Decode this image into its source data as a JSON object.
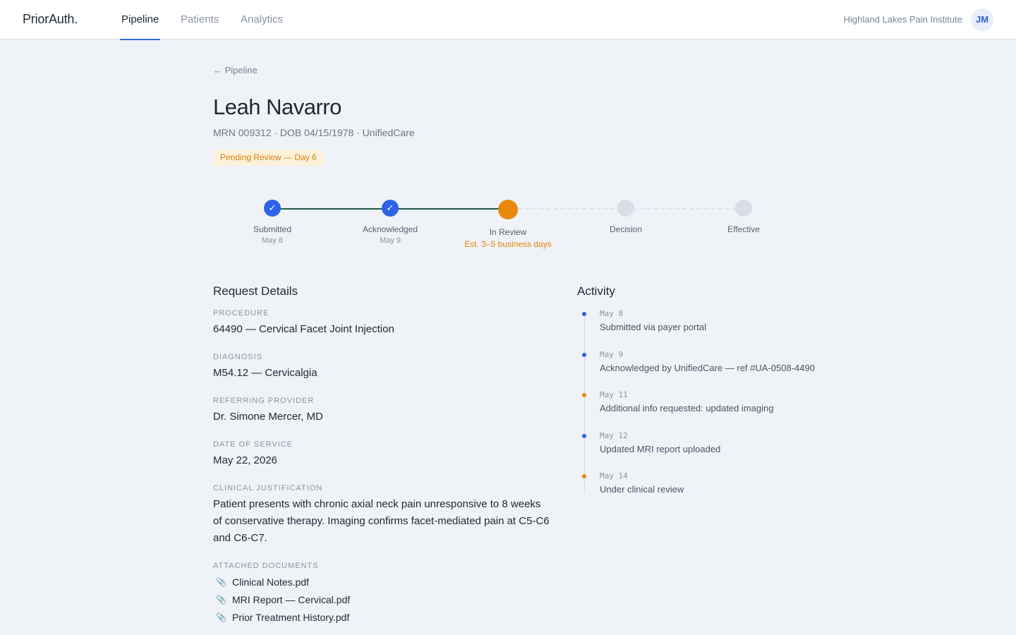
{
  "header": {
    "brand": "PriorAuth.",
    "tabs": [
      {
        "label": "Pipeline",
        "active": true
      },
      {
        "label": "Patients",
        "active": false
      },
      {
        "label": "Analytics",
        "active": false
      }
    ],
    "clinic": "Highland Lakes Pain Institute",
    "avatar_initials": "JM"
  },
  "back_link": "← Pipeline",
  "patient": {
    "name": "Leah Navarro",
    "meta": "MRN 009312 · DOB 04/15/1978 · UnifiedCare",
    "status": "Pending Review — Day 6"
  },
  "colors": {
    "accent": "#2e63e6",
    "warning": "#e8890c",
    "done_track": "#1d5e46",
    "badge_bg": "#fdf1dc"
  },
  "steps": [
    {
      "label": "Submitted",
      "sub": "May 8",
      "state": "done",
      "icon": "check-icon"
    },
    {
      "label": "Acknowledged",
      "sub": "May 9",
      "state": "done",
      "icon": "check-icon"
    },
    {
      "label": "In Review",
      "sub": "Est. 3–5 business days",
      "state": "current"
    },
    {
      "label": "Decision",
      "sub": "",
      "state": "todo"
    },
    {
      "label": "Effective",
      "sub": "",
      "state": "todo"
    }
  ],
  "details": {
    "title": "Request Details",
    "procedure_label": "PROCEDURE",
    "procedure": "64490 — Cervical Facet Joint Injection",
    "diagnosis_label": "DIAGNOSIS",
    "diagnosis": "M54.12 — Cervicalgia",
    "provider_label": "REFERRING PROVIDER",
    "provider": "Dr. Simone Mercer, MD",
    "dos_label": "DATE OF SERVICE",
    "dos": "May 22, 2026",
    "justification_label": "CLINICAL JUSTIFICATION",
    "justification": "Patient presents with chronic axial neck pain unresponsive to 8 weeks of conservative therapy. Imaging confirms facet-mediated pain at C5-C6 and C6-C7.",
    "documents_label": "ATTACHED DOCUMENTS",
    "documents": [
      "Clinical Notes.pdf",
      "MRI Report — Cervical.pdf",
      "Prior Treatment History.pdf"
    ]
  },
  "activity": {
    "title": "Activity",
    "items": [
      {
        "date": "May 8",
        "text": "Submitted via payer portal",
        "color": "#2e63e6"
      },
      {
        "date": "May 9",
        "text": "Acknowledged by UnifiedCare — ref #UA-0508-4490",
        "color": "#2e63e6"
      },
      {
        "date": "May 11",
        "text": "Additional info requested: updated imaging",
        "color": "#e8890c"
      },
      {
        "date": "May 12",
        "text": "Updated MRI report uploaded",
        "color": "#2e63e6"
      },
      {
        "date": "May 14",
        "text": "Under clinical review",
        "color": "#e8890c"
      }
    ]
  }
}
